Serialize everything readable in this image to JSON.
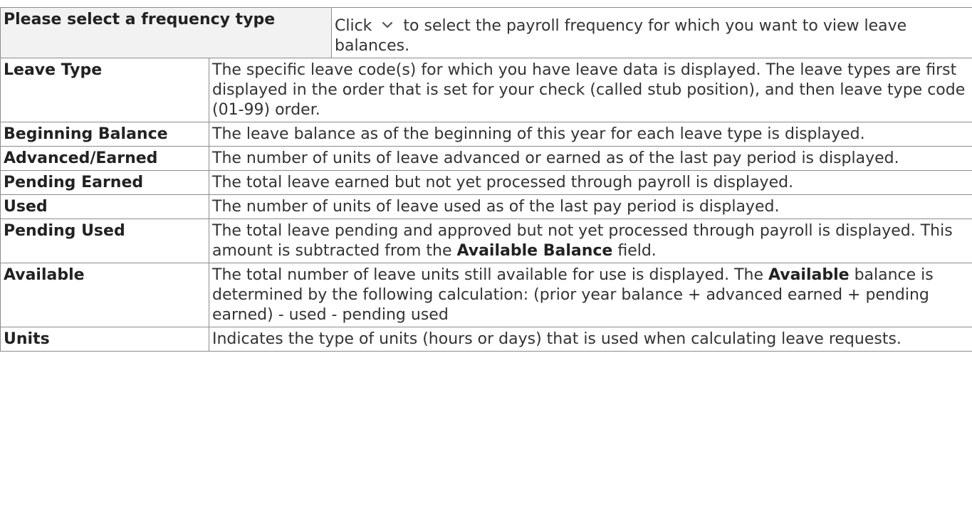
{
  "rows": [
    {
      "term": "Please select a frequency type",
      "desc_before": "Click ",
      "icon": "chevron-down-icon",
      "desc_after": " to select the payroll frequency for which you want to view leave balances."
    },
    {
      "term": "Leave Type",
      "desc": "The specific leave code(s) for which you have leave data is displayed. The leave types are first displayed in the order that is set for your check (called stub position), and then leave type code (01-99) order."
    },
    {
      "term": "Beginning Balance",
      "desc": "The leave balance as of the beginning of this year for each leave type is displayed."
    },
    {
      "term": "Advanced/Earned",
      "desc": "The number of units of leave advanced or earned as of the last pay period is displayed."
    },
    {
      "term": "Pending Earned",
      "desc": "The total leave earned but not yet processed through payroll is displayed."
    },
    {
      "term": "Used",
      "desc": "The number of units of leave used as of the last pay period is displayed."
    },
    {
      "term": "Pending Used",
      "desc_part1": "The total leave pending and approved but not yet processed through payroll is displayed. This amount is subtracted from the ",
      "desc_bold": "Available Balance",
      "desc_part2": " field."
    },
    {
      "term": "Available",
      "desc_part1": "The total number of leave units still available for use is displayed. The ",
      "desc_bold": "Available",
      "desc_part2": " balance is determined by the following calculation: (prior year balance + advanced earned + pending earned) - used - pending used"
    },
    {
      "term": "Units",
      "desc": "Indicates the type of units (hours or days) that is used when calculating leave requests."
    }
  ],
  "colors": {
    "border": "#8c8c8c",
    "text": "#333333",
    "header_bg": "#f2f2f2"
  }
}
